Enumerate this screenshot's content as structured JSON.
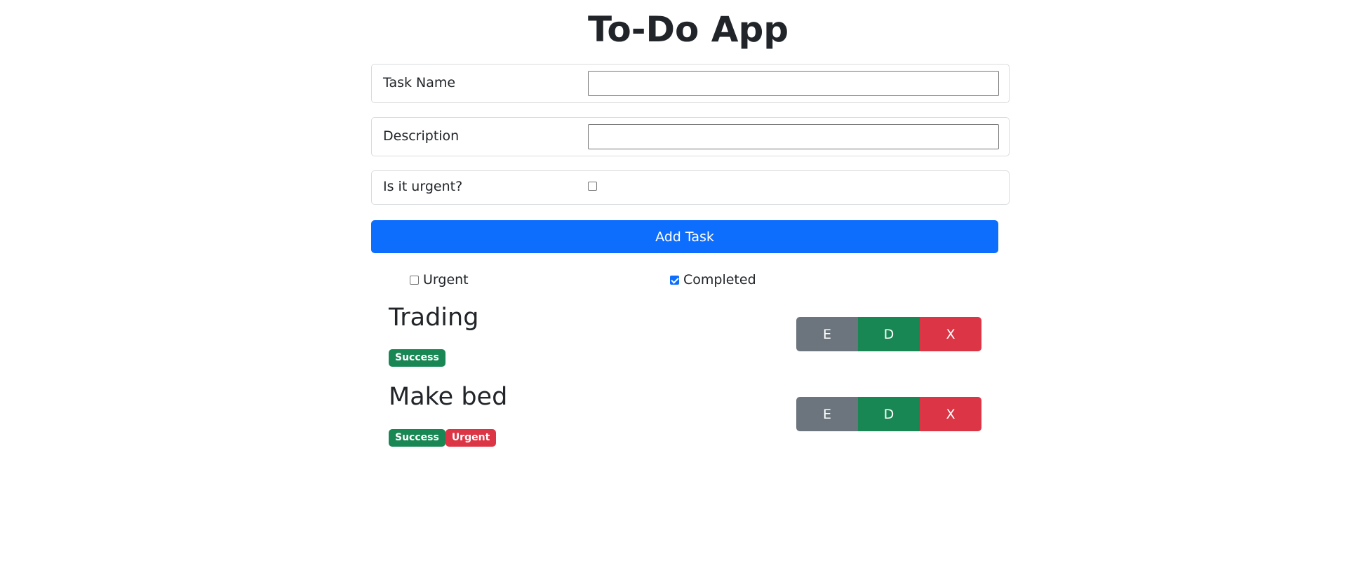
{
  "app": {
    "title": "To-Do App"
  },
  "form": {
    "task_name": {
      "label": "Task Name",
      "value": "",
      "placeholder": ""
    },
    "description": {
      "label": "Description",
      "value": "",
      "placeholder": ""
    },
    "urgent": {
      "label": "Is it urgent?",
      "checked": false
    },
    "add_button_label": "Add Task"
  },
  "filters": {
    "urgent": {
      "label": "Urgent",
      "checked": false
    },
    "completed": {
      "label": "Completed",
      "checked": true
    }
  },
  "tasks": [
    {
      "title": "Trading",
      "badges": [
        "Success"
      ],
      "actions": {
        "edit": "E",
        "done": "D",
        "delete": "X"
      }
    },
    {
      "title": "Make bed",
      "badges": [
        "Success",
        "Urgent"
      ],
      "actions": {
        "edit": "E",
        "done": "D",
        "delete": "X"
      }
    }
  ],
  "colors": {
    "primary": "#0d6efd",
    "success": "#198754",
    "danger": "#dc3545",
    "secondary": "#6c757d"
  }
}
